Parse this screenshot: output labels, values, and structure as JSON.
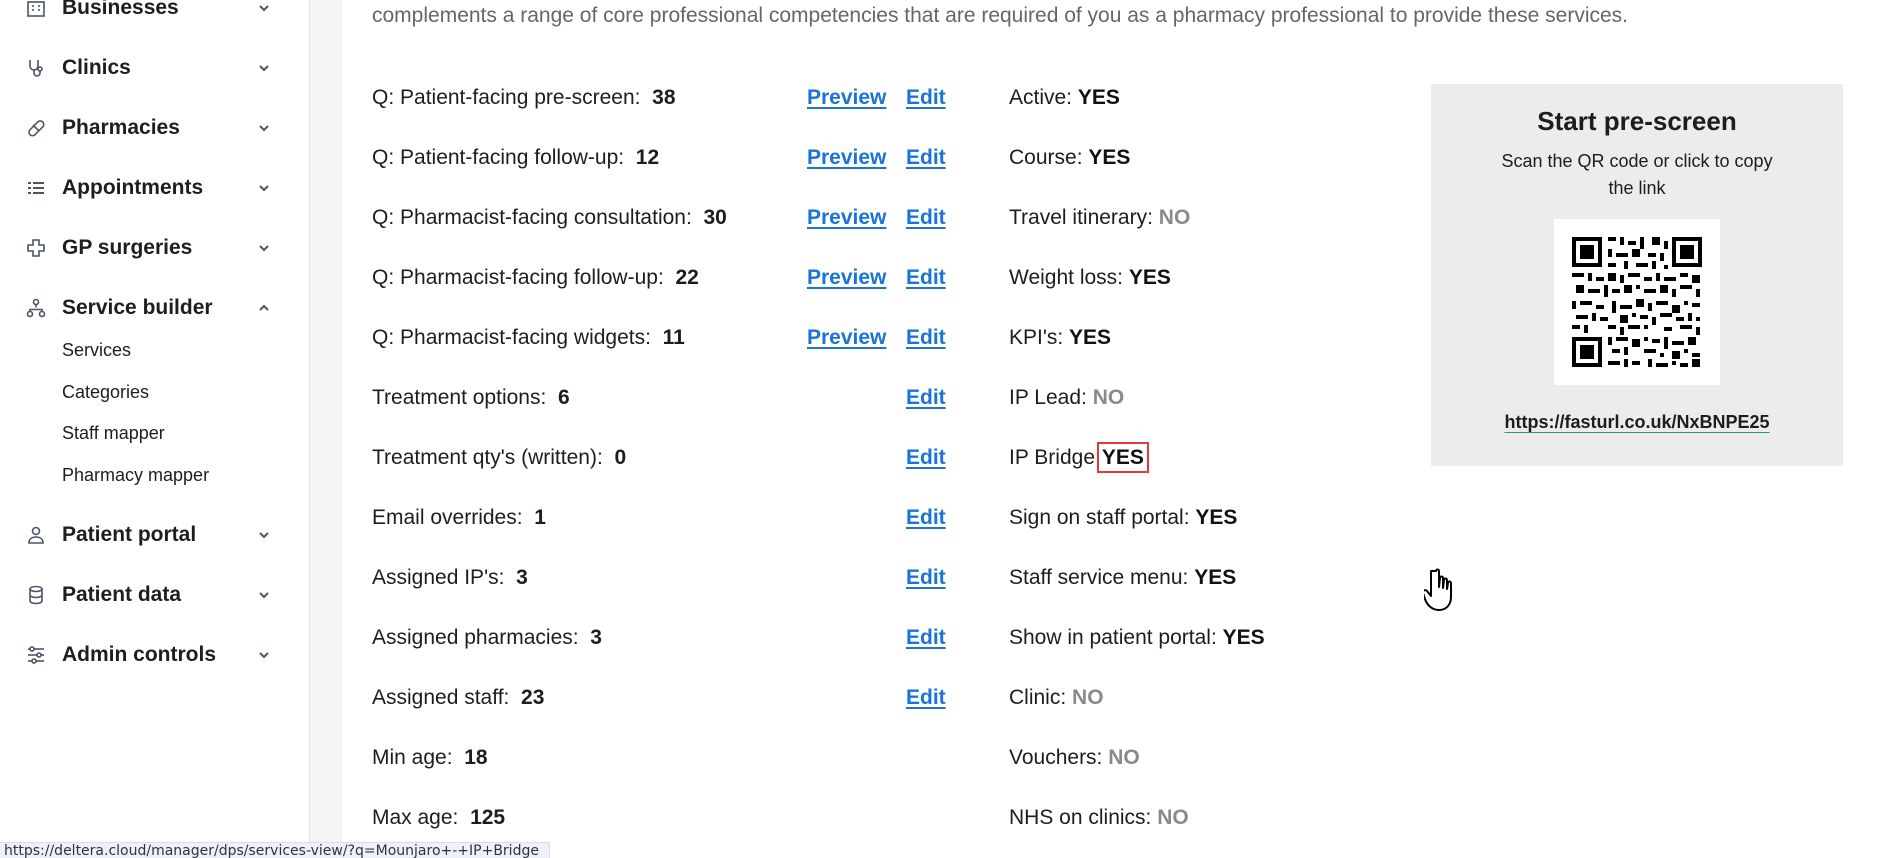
{
  "sidebar": {
    "items": [
      {
        "label": "Businesses",
        "icon": "building-icon"
      },
      {
        "label": "Clinics",
        "icon": "stethoscope-icon"
      },
      {
        "label": "Pharmacies",
        "icon": "pill-icon"
      },
      {
        "label": "Appointments",
        "icon": "list-icon"
      },
      {
        "label": "GP surgeries",
        "icon": "medical-cross-icon"
      },
      {
        "label": "Service builder",
        "icon": "sitemap-icon"
      },
      {
        "label": "Patient portal",
        "icon": "user-icon"
      },
      {
        "label": "Patient data",
        "icon": "database-icon"
      },
      {
        "label": "Admin controls",
        "icon": "sliders-icon"
      }
    ],
    "service_builder_sub": [
      "Services",
      "Categories",
      "Staff mapper",
      "Pharmacy mapper"
    ]
  },
  "main": {
    "intro": "complements a range of core professional competencies that are required of you as a pharmacy professional to provide these services.",
    "rows": [
      {
        "label": "Q: Patient-facing pre-screen:",
        "value": "38"
      },
      {
        "label": "Q: Patient-facing follow-up:",
        "value": "12"
      },
      {
        "label": "Q: Pharmacist-facing consultation:",
        "value": "30"
      },
      {
        "label": "Q: Pharmacist-facing follow-up:",
        "value": "22"
      },
      {
        "label": "Q: Pharmacist-facing widgets:",
        "value": "11"
      },
      {
        "label": "Treatment options:",
        "value": "6"
      },
      {
        "label": "Treatment qty's (written):",
        "value": "0"
      },
      {
        "label": "Email overrides:",
        "value": "1"
      },
      {
        "label": "Assigned IP's:",
        "value": "3"
      },
      {
        "label": "Assigned pharmacies:",
        "value": "3"
      },
      {
        "label": "Assigned staff:",
        "value": "23"
      },
      {
        "label": "Min age:",
        "value": "18"
      },
      {
        "label": "Max age:",
        "value": "125"
      }
    ],
    "preview_label": "Preview",
    "edit_label": "Edit",
    "flags": [
      {
        "label": "Active:",
        "value": "YES"
      },
      {
        "label": "Course:",
        "value": "YES"
      },
      {
        "label": "Travel itinerary:",
        "value": "NO"
      },
      {
        "label": "Weight loss:",
        "value": "YES"
      },
      {
        "label": "KPI's:",
        "value": "YES"
      },
      {
        "label": "IP Lead:",
        "value": "NO"
      },
      {
        "label": "IP Bridge:",
        "value": "YES"
      },
      {
        "label": "Sign on staff portal:",
        "value": "YES"
      },
      {
        "label": "Staff service menu:",
        "value": "YES"
      },
      {
        "label": "Show in patient portal:",
        "value": "YES"
      },
      {
        "label": "Clinic:",
        "value": "NO"
      },
      {
        "label": "Vouchers:",
        "value": "NO"
      },
      {
        "label": "NHS on clinics:",
        "value": "NO"
      }
    ],
    "prescreen": {
      "title": "Start pre-screen",
      "subtitle": "Scan the QR code or click to copy the link",
      "link": "https://fasturl.co.uk/NxBNPE25"
    }
  },
  "status_url": "https://deltera.cloud/manager/dps/services-view/?q=Mounjaro+-+IP+Bridge",
  "colors": {
    "link": "#1a73d8",
    "highlight": "#e03b3b",
    "no_value": "#8a8a8a",
    "panel": "#ececec"
  }
}
